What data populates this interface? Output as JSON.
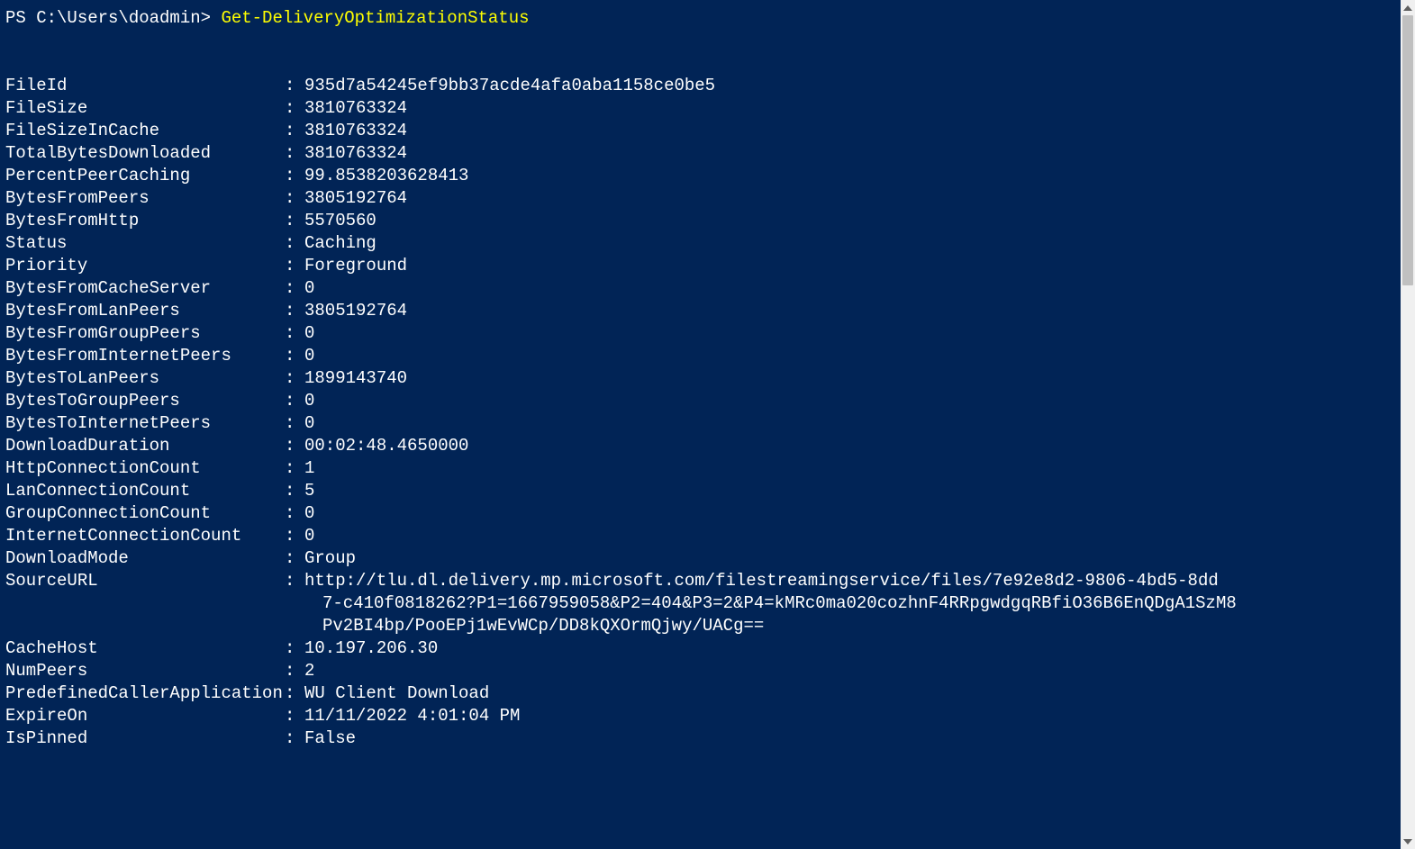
{
  "prompt": {
    "prefix": "PS C:\\Users\\doadmin> ",
    "command": "Get-DeliveryOptimizationStatus"
  },
  "fields": [
    {
      "key": "FileId",
      "value": "935d7a54245ef9bb37acde4afa0aba1158ce0be5"
    },
    {
      "key": "FileSize",
      "value": "3810763324"
    },
    {
      "key": "FileSizeInCache",
      "value": "3810763324"
    },
    {
      "key": "TotalBytesDownloaded",
      "value": "3810763324"
    },
    {
      "key": "PercentPeerCaching",
      "value": "99.8538203628413"
    },
    {
      "key": "BytesFromPeers",
      "value": "3805192764"
    },
    {
      "key": "BytesFromHttp",
      "value": "5570560"
    },
    {
      "key": "Status",
      "value": "Caching"
    },
    {
      "key": "Priority",
      "value": "Foreground"
    },
    {
      "key": "BytesFromCacheServer",
      "value": "0"
    },
    {
      "key": "BytesFromLanPeers",
      "value": "3805192764"
    },
    {
      "key": "BytesFromGroupPeers",
      "value": "0"
    },
    {
      "key": "BytesFromInternetPeers",
      "value": "0"
    },
    {
      "key": "BytesToLanPeers",
      "value": "1899143740"
    },
    {
      "key": "BytesToGroupPeers",
      "value": "0"
    },
    {
      "key": "BytesToInternetPeers",
      "value": "0"
    },
    {
      "key": "DownloadDuration",
      "value": "00:02:48.4650000"
    },
    {
      "key": "HttpConnectionCount",
      "value": "1"
    },
    {
      "key": "LanConnectionCount",
      "value": "5"
    },
    {
      "key": "GroupConnectionCount",
      "value": "0"
    },
    {
      "key": "InternetConnectionCount",
      "value": "0"
    },
    {
      "key": "DownloadMode",
      "value": "Group"
    }
  ],
  "sourceUrl": {
    "key": "SourceURL",
    "line1": "http://tlu.dl.delivery.mp.microsoft.com/filestreamingservice/files/7e92e8d2-9806-4bd5-8dd",
    "line2": "7-c410f0818262?P1=1667959058&P2=404&P3=2&P4=kMRc0ma020cozhnF4RRpgwdgqRBfiO36B6EnQDgA1SzM8",
    "line3": "Pv2BI4bp/PooEPj1wEvWCp/DD8kQXOrmQjwy/UACg=="
  },
  "fields2": [
    {
      "key": "CacheHost",
      "value": "10.197.206.30"
    },
    {
      "key": "NumPeers",
      "value": "2"
    },
    {
      "key": "PredefinedCallerApplication",
      "value": "WU Client Download"
    },
    {
      "key": "ExpireOn",
      "value": "11/11/2022 4:01:04 PM"
    },
    {
      "key": "IsPinned",
      "value": "False"
    }
  ]
}
